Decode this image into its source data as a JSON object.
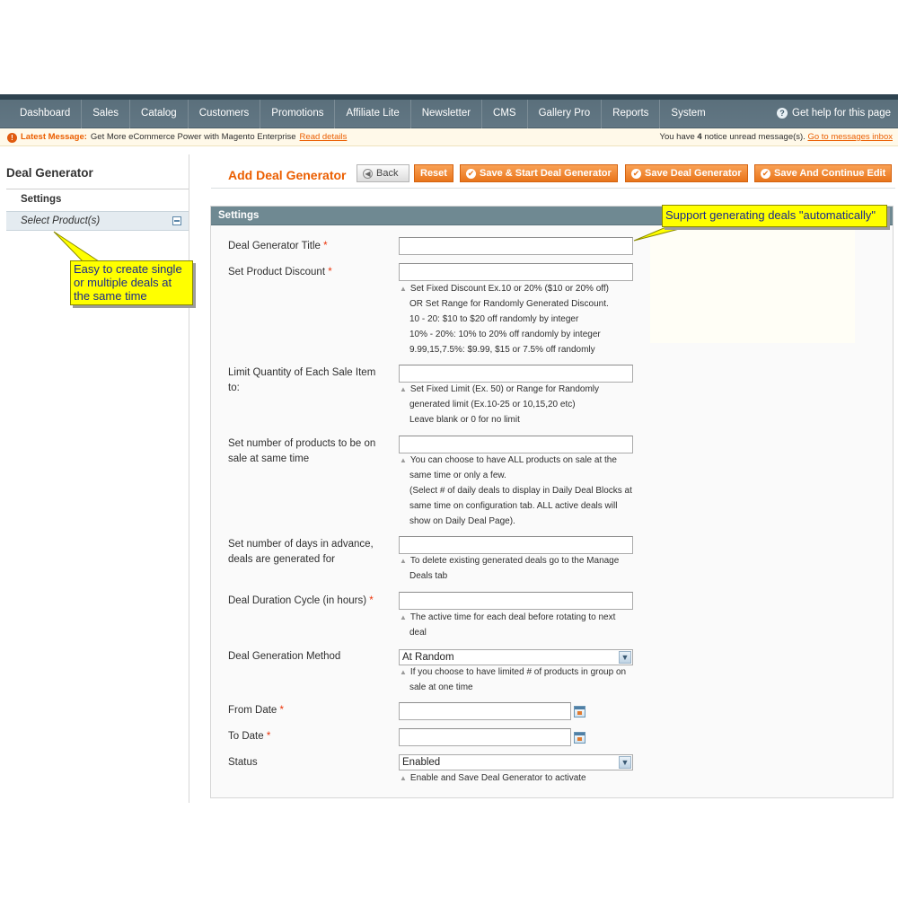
{
  "nav": {
    "items": [
      "Dashboard",
      "Sales",
      "Catalog",
      "Customers",
      "Promotions",
      "Affiliate Lite",
      "Newsletter",
      "CMS",
      "Gallery Pro",
      "Reports",
      "System"
    ],
    "help": "Get help for this page"
  },
  "message_bar": {
    "title": "Latest Message:",
    "text": "Get More eCommerce Power with Magento Enterprise",
    "link": "Read details",
    "right_prefix": "You have",
    "right_count": "4",
    "right_suffix": "notice unread message(s).",
    "right_link": "Go to messages inbox"
  },
  "sidebar": {
    "title": "Deal Generator",
    "tab_header": "Settings",
    "tab_item": "Select Product(s)"
  },
  "callouts": {
    "left": "Easy to create single or multiple deals at the same time",
    "right": "Support generating deals \"automatically\""
  },
  "header": {
    "title": "Add Deal Generator",
    "back": "Back",
    "reset": "Reset",
    "save_start": "Save & Start Deal Generator",
    "save": "Save Deal Generator",
    "save_continue": "Save And Continue Edit"
  },
  "panel": {
    "title": "Settings"
  },
  "form": {
    "title_label": "Deal Generator Title",
    "discount_label": "Set Product Discount",
    "discount_notes": [
      "Set Fixed Discount Ex.10 or 20% ($10 or 20% off)",
      "OR Set Range for Randomly Generated Discount.",
      "10 - 20: $10 to $20 off randomly by integer",
      "10% - 20%: 10% to 20% off randomly by integer",
      "9.99,15,7.5%: $9.99, $15 or 7.5% off randomly"
    ],
    "limit_label": "Limit Quantity of Each Sale Item to:",
    "limit_notes": [
      "Set Fixed Limit (Ex. 50) or Range for Randomly",
      "generated limit (Ex.10-25 or 10,15,20 etc)",
      "Leave blank or 0 for no limit"
    ],
    "products_label": "Set number of products to be on sale at same time",
    "products_notes": [
      "You can choose to have ALL products on sale at the",
      "same time or only a few.",
      "(Select # of daily deals to display in Daily Deal Blocks at",
      "same time on configuration tab. ALL active deals will",
      "show on Daily Deal Page)."
    ],
    "days_label": "Set number of days in advance, deals are generated for",
    "days_notes": [
      "To delete existing generated deals go to the Manage",
      "Deals tab"
    ],
    "duration_label": "Deal Duration Cycle (in hours)",
    "duration_notes": [
      "The active time for each deal before rotating to next",
      "deal"
    ],
    "method_label": "Deal Generation Method",
    "method_value": "At Random",
    "method_notes": [
      "If you choose to have limited # of products in group on",
      "sale at one time"
    ],
    "from_label": "From Date",
    "to_label": "To Date",
    "status_label": "Status",
    "status_value": "Enabled",
    "status_notes": [
      "Enable and Save Deal Generator to activate"
    ],
    "required_mark": "*"
  }
}
